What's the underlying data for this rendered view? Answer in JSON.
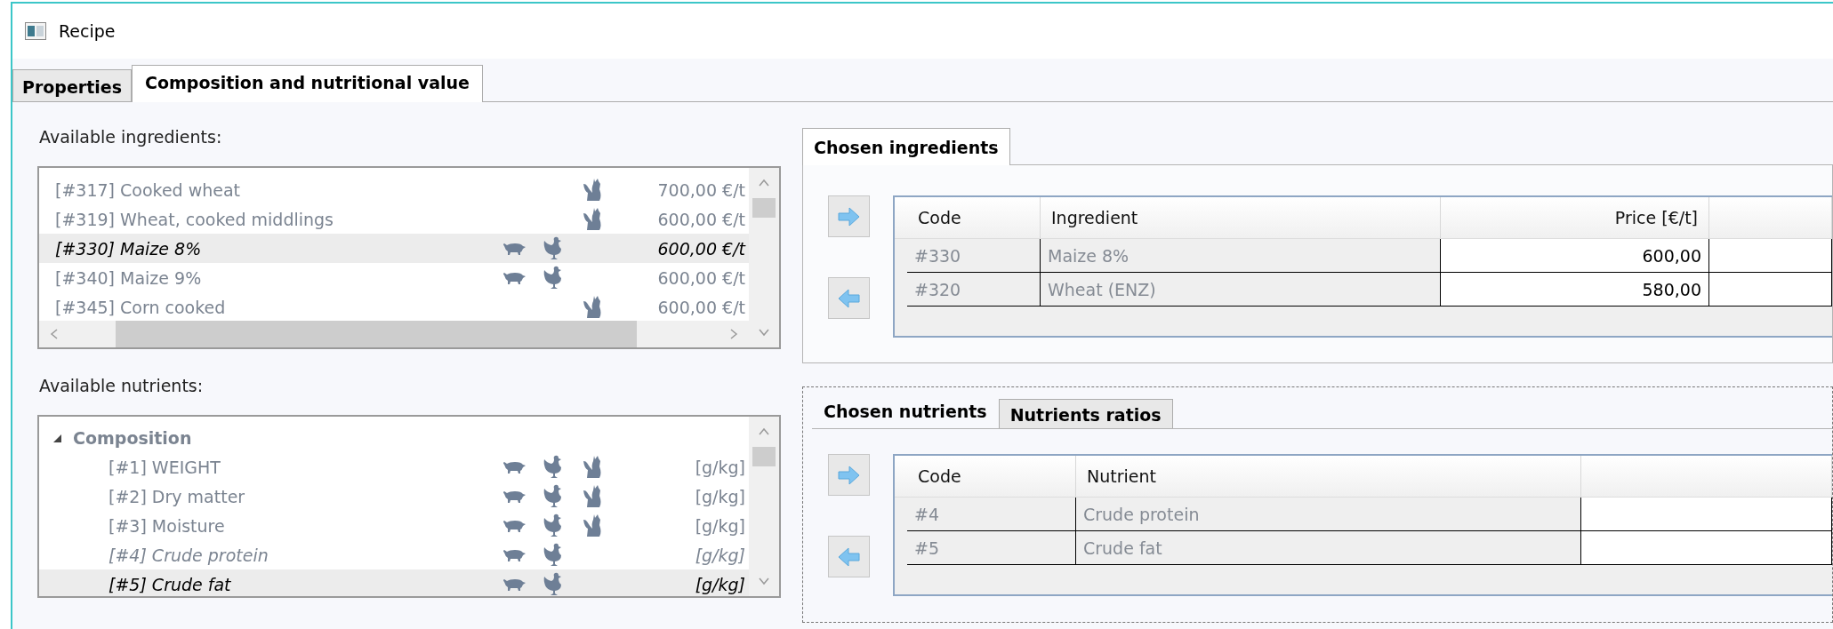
{
  "window": {
    "title": "Recipe"
  },
  "tabs": [
    {
      "label": "Properties",
      "selected": false
    },
    {
      "label": "Composition and nutritional value",
      "selected": true
    }
  ],
  "ingredients_panel": {
    "label": "Available ingredients:",
    "items": [
      {
        "label": "[#317] Cooked wheat",
        "pig": false,
        "hen": false,
        "cat": true,
        "price": "700,00 €/t",
        "chosen": false,
        "selected": false
      },
      {
        "label": "[#319] Wheat, cooked middlings",
        "pig": false,
        "hen": false,
        "cat": true,
        "price": "600,00 €/t",
        "chosen": false,
        "selected": false
      },
      {
        "label": "[#330] Maize 8%",
        "pig": true,
        "hen": true,
        "cat": false,
        "price": "600,00 €/t",
        "chosen": true,
        "selected": true
      },
      {
        "label": "[#340] Maize 9%",
        "pig": true,
        "hen": true,
        "cat": false,
        "price": "600,00 €/t",
        "chosen": false,
        "selected": false
      },
      {
        "label": "[#345] Corn cooked",
        "pig": false,
        "hen": false,
        "cat": true,
        "price": "600,00 €/t",
        "chosen": false,
        "selected": false
      }
    ]
  },
  "nutrients_panel": {
    "label": "Available nutrients:",
    "tree": [
      {
        "label": "Composition",
        "expanded": true,
        "children": [
          {
            "label": "[#1] WEIGHT",
            "pig": true,
            "hen": true,
            "cat": true,
            "unit": "[g/kg]",
            "chosen": false,
            "selected": false
          },
          {
            "label": "[#2] Dry matter",
            "pig": true,
            "hen": true,
            "cat": true,
            "unit": "[g/kg]",
            "chosen": false,
            "selected": false
          },
          {
            "label": "[#3] Moisture",
            "pig": true,
            "hen": true,
            "cat": true,
            "unit": "[g/kg]",
            "chosen": false,
            "selected": false
          },
          {
            "label": "[#4] Crude protein",
            "pig": true,
            "hen": true,
            "cat": false,
            "unit": "[g/kg]",
            "chosen": true,
            "selected": false
          },
          {
            "label": "[#5] Crude fat",
            "pig": true,
            "hen": true,
            "cat": false,
            "unit": "[g/kg]",
            "chosen": true,
            "selected": true
          }
        ]
      }
    ]
  },
  "chosen_ingredients": {
    "tabs": [
      {
        "label": "Chosen ingredients",
        "selected": true
      }
    ],
    "table": {
      "columns": [
        {
          "label": "Code",
          "editable": false
        },
        {
          "label": "Ingredient",
          "editable": false
        },
        {
          "label": "Price [€/t]",
          "editable": true
        }
      ],
      "rows": [
        {
          "cells": [
            "#330",
            "Maize 8%",
            "600,00"
          ]
        },
        {
          "cells": [
            "#320",
            "Wheat (ENZ)",
            "580,00"
          ]
        }
      ]
    }
  },
  "chosen_nutrients": {
    "tabs": [
      {
        "label": "Chosen nutrients",
        "selected": true
      },
      {
        "label": "Nutrients ratios",
        "selected": false
      }
    ],
    "table": {
      "columns": [
        {
          "label": "Code",
          "editable": false
        },
        {
          "label": "Nutrient",
          "editable": false
        }
      ],
      "rows": [
        {
          "cells": [
            "#4",
            "Crude protein"
          ]
        },
        {
          "cells": [
            "#5",
            "Crude fat"
          ]
        }
      ]
    }
  }
}
